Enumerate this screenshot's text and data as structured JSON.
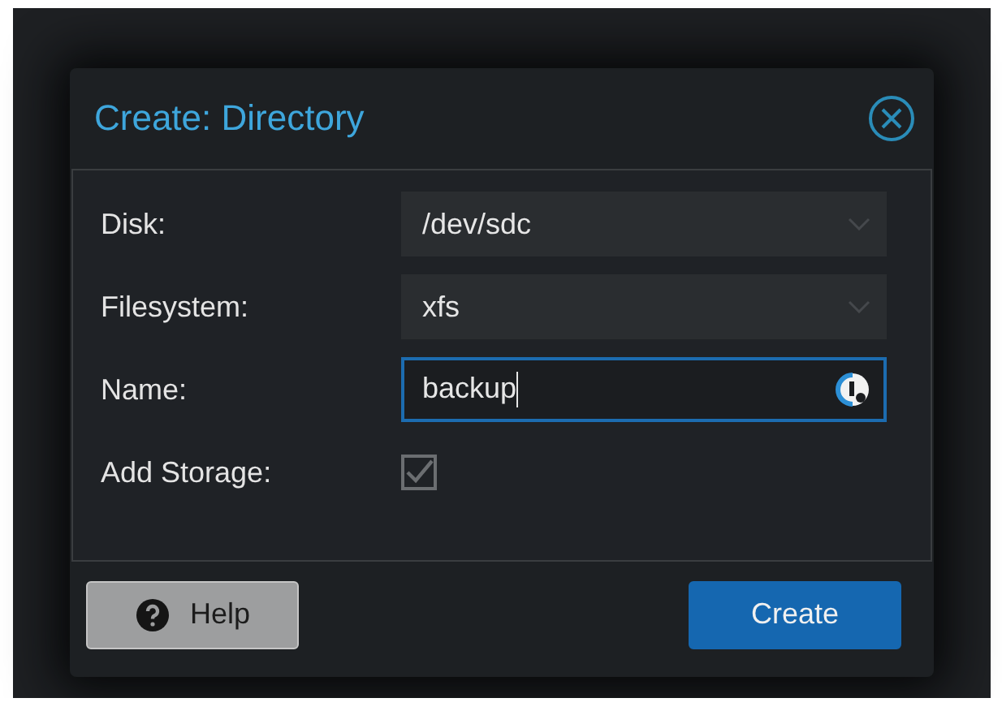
{
  "dialog": {
    "title": "Create: Directory"
  },
  "fields": [
    {
      "kind": "select",
      "label": "Disk:",
      "value": "/dev/sdc"
    },
    {
      "kind": "select",
      "label": "Filesystem:",
      "value": "xfs"
    },
    {
      "kind": "text",
      "label": "Name:",
      "value": "backup",
      "focused": true
    },
    {
      "kind": "checkbox",
      "label": "Add Storage:",
      "checked": true,
      "disabled": true
    }
  ],
  "buttons": [
    {
      "kind": "help",
      "label": "Help"
    },
    {
      "kind": "primary",
      "label": "Create"
    }
  ]
}
